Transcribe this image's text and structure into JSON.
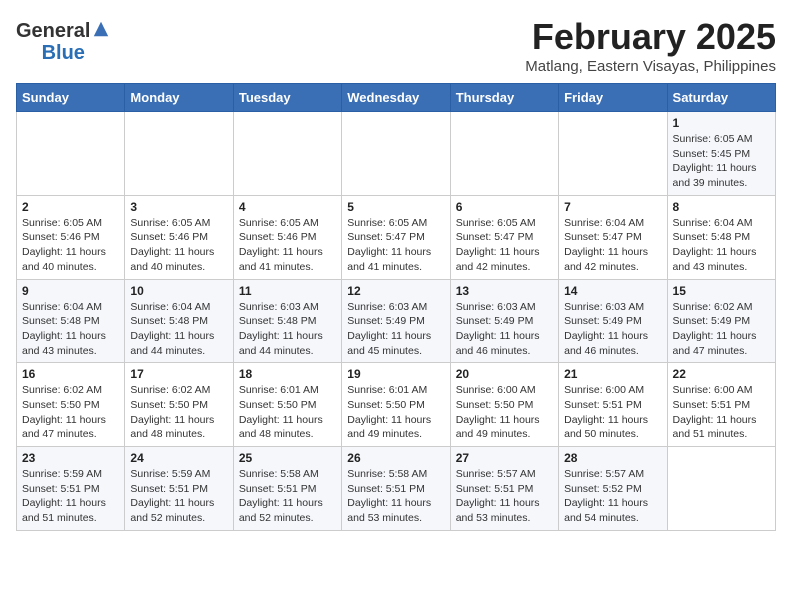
{
  "header": {
    "logo_general": "General",
    "logo_blue": "Blue",
    "month_title": "February 2025",
    "location": "Matlang, Eastern Visayas, Philippines"
  },
  "calendar": {
    "days_of_week": [
      "Sunday",
      "Monday",
      "Tuesday",
      "Wednesday",
      "Thursday",
      "Friday",
      "Saturday"
    ],
    "weeks": [
      [
        {
          "day": "",
          "info": ""
        },
        {
          "day": "",
          "info": ""
        },
        {
          "day": "",
          "info": ""
        },
        {
          "day": "",
          "info": ""
        },
        {
          "day": "",
          "info": ""
        },
        {
          "day": "",
          "info": ""
        },
        {
          "day": "1",
          "info": "Sunrise: 6:05 AM\nSunset: 5:45 PM\nDaylight: 11 hours and 39 minutes."
        }
      ],
      [
        {
          "day": "2",
          "info": "Sunrise: 6:05 AM\nSunset: 5:46 PM\nDaylight: 11 hours and 40 minutes."
        },
        {
          "day": "3",
          "info": "Sunrise: 6:05 AM\nSunset: 5:46 PM\nDaylight: 11 hours and 40 minutes."
        },
        {
          "day": "4",
          "info": "Sunrise: 6:05 AM\nSunset: 5:46 PM\nDaylight: 11 hours and 41 minutes."
        },
        {
          "day": "5",
          "info": "Sunrise: 6:05 AM\nSunset: 5:47 PM\nDaylight: 11 hours and 41 minutes."
        },
        {
          "day": "6",
          "info": "Sunrise: 6:05 AM\nSunset: 5:47 PM\nDaylight: 11 hours and 42 minutes."
        },
        {
          "day": "7",
          "info": "Sunrise: 6:04 AM\nSunset: 5:47 PM\nDaylight: 11 hours and 42 minutes."
        },
        {
          "day": "8",
          "info": "Sunrise: 6:04 AM\nSunset: 5:48 PM\nDaylight: 11 hours and 43 minutes."
        }
      ],
      [
        {
          "day": "9",
          "info": "Sunrise: 6:04 AM\nSunset: 5:48 PM\nDaylight: 11 hours and 43 minutes."
        },
        {
          "day": "10",
          "info": "Sunrise: 6:04 AM\nSunset: 5:48 PM\nDaylight: 11 hours and 44 minutes."
        },
        {
          "day": "11",
          "info": "Sunrise: 6:03 AM\nSunset: 5:48 PM\nDaylight: 11 hours and 44 minutes."
        },
        {
          "day": "12",
          "info": "Sunrise: 6:03 AM\nSunset: 5:49 PM\nDaylight: 11 hours and 45 minutes."
        },
        {
          "day": "13",
          "info": "Sunrise: 6:03 AM\nSunset: 5:49 PM\nDaylight: 11 hours and 46 minutes."
        },
        {
          "day": "14",
          "info": "Sunrise: 6:03 AM\nSunset: 5:49 PM\nDaylight: 11 hours and 46 minutes."
        },
        {
          "day": "15",
          "info": "Sunrise: 6:02 AM\nSunset: 5:49 PM\nDaylight: 11 hours and 47 minutes."
        }
      ],
      [
        {
          "day": "16",
          "info": "Sunrise: 6:02 AM\nSunset: 5:50 PM\nDaylight: 11 hours and 47 minutes."
        },
        {
          "day": "17",
          "info": "Sunrise: 6:02 AM\nSunset: 5:50 PM\nDaylight: 11 hours and 48 minutes."
        },
        {
          "day": "18",
          "info": "Sunrise: 6:01 AM\nSunset: 5:50 PM\nDaylight: 11 hours and 48 minutes."
        },
        {
          "day": "19",
          "info": "Sunrise: 6:01 AM\nSunset: 5:50 PM\nDaylight: 11 hours and 49 minutes."
        },
        {
          "day": "20",
          "info": "Sunrise: 6:00 AM\nSunset: 5:50 PM\nDaylight: 11 hours and 49 minutes."
        },
        {
          "day": "21",
          "info": "Sunrise: 6:00 AM\nSunset: 5:51 PM\nDaylight: 11 hours and 50 minutes."
        },
        {
          "day": "22",
          "info": "Sunrise: 6:00 AM\nSunset: 5:51 PM\nDaylight: 11 hours and 51 minutes."
        }
      ],
      [
        {
          "day": "23",
          "info": "Sunrise: 5:59 AM\nSunset: 5:51 PM\nDaylight: 11 hours and 51 minutes."
        },
        {
          "day": "24",
          "info": "Sunrise: 5:59 AM\nSunset: 5:51 PM\nDaylight: 11 hours and 52 minutes."
        },
        {
          "day": "25",
          "info": "Sunrise: 5:58 AM\nSunset: 5:51 PM\nDaylight: 11 hours and 52 minutes."
        },
        {
          "day": "26",
          "info": "Sunrise: 5:58 AM\nSunset: 5:51 PM\nDaylight: 11 hours and 53 minutes."
        },
        {
          "day": "27",
          "info": "Sunrise: 5:57 AM\nSunset: 5:51 PM\nDaylight: 11 hours and 53 minutes."
        },
        {
          "day": "28",
          "info": "Sunrise: 5:57 AM\nSunset: 5:52 PM\nDaylight: 11 hours and 54 minutes."
        },
        {
          "day": "",
          "info": ""
        }
      ]
    ]
  }
}
